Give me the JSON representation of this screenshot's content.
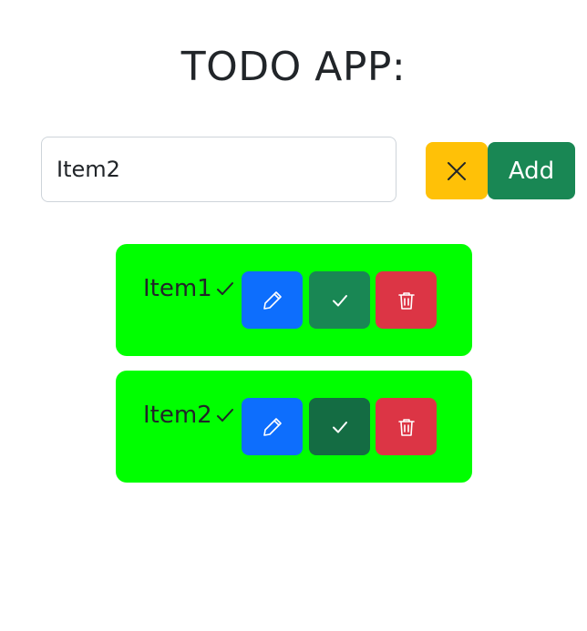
{
  "app": {
    "title": "TODO APP:"
  },
  "form": {
    "input_value": "Item2",
    "clear_icon": "x-icon",
    "add_label": "Add"
  },
  "todos": [
    {
      "text": "Item1",
      "done_mark": "check-icon",
      "edit_icon": "pencil-icon",
      "done_icon": "check-icon",
      "delete_icon": "trash-icon"
    },
    {
      "text": "Item2",
      "done_mark": "check-icon",
      "edit_icon": "pencil-icon",
      "done_icon": "check-icon",
      "delete_icon": "trash-icon"
    }
  ],
  "colors": {
    "card_bg": "#00ff00",
    "edit": "#0d6efd",
    "done": "#198754",
    "done_active": "#146c43",
    "delete": "#dc3545",
    "clear": "#ffc107",
    "add": "#198754"
  }
}
